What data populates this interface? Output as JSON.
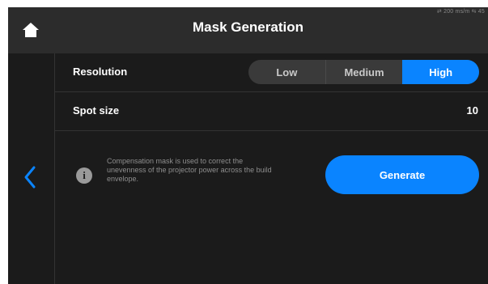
{
  "header": {
    "title": "Mask Generation",
    "status_text": "⇄ 200 ms/m ⇆ 45"
  },
  "icons": {
    "home": "home-icon",
    "back": "chevron-left-icon",
    "info": "info-icon"
  },
  "resolution": {
    "label": "Resolution",
    "options": [
      "Low",
      "Medium",
      "High"
    ],
    "selected": "High"
  },
  "spot_size": {
    "label": "Spot size",
    "value": "10"
  },
  "info": {
    "icon_glyph": "i",
    "text": "Compensation mask is used to correct the unevenness of the projector power across the build envelope."
  },
  "generate": {
    "label": "Generate"
  },
  "colors": {
    "accent": "#0a84ff",
    "background": "#1b1b1b",
    "header": "#2c2c2c"
  }
}
